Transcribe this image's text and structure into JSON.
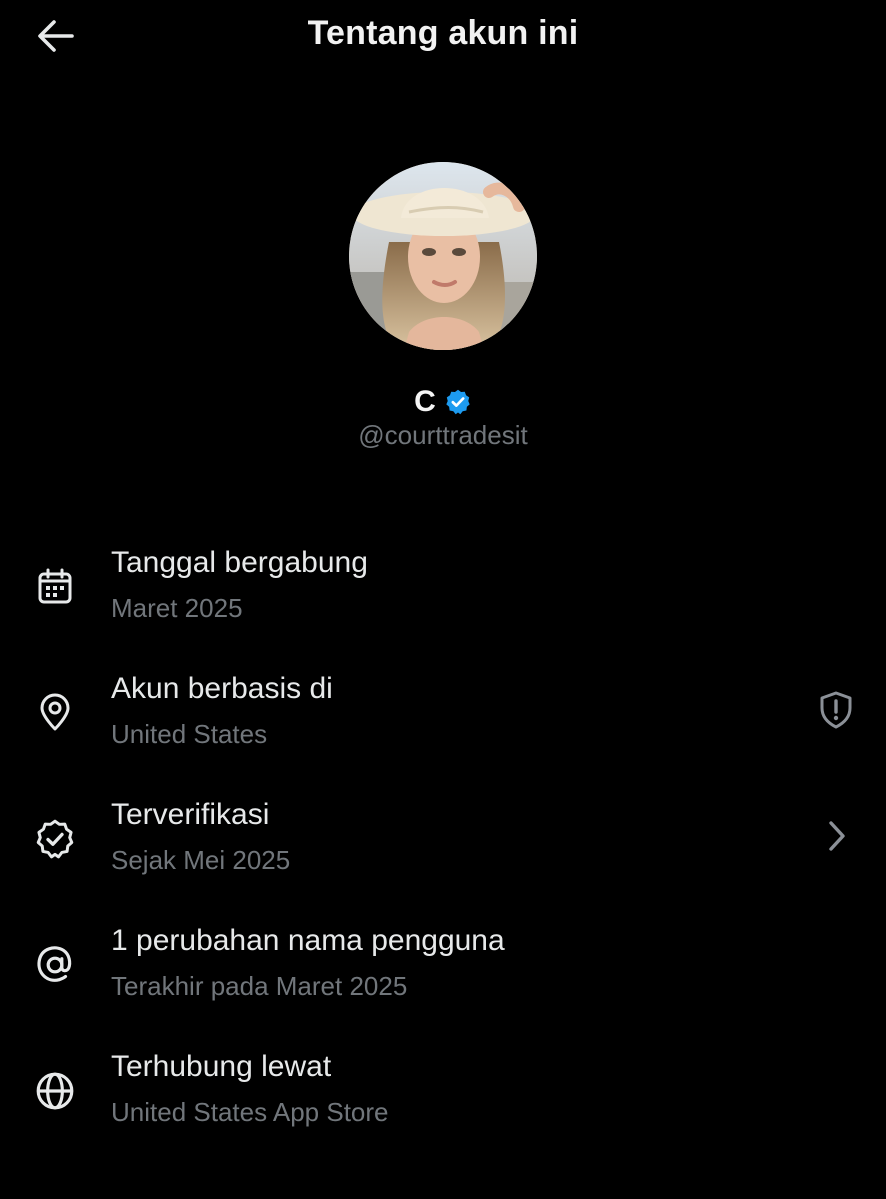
{
  "header": {
    "title": "Tentang akun ini",
    "back_icon": "arrow-left-icon"
  },
  "profile": {
    "display_name": "C",
    "handle": "@courttradesit",
    "verified_badge_color": "#1d9bf0",
    "verified_icon": "verified-badge-icon"
  },
  "colors": {
    "background": "#000000",
    "primary_text": "#e7e9ea",
    "secondary_text": "#71767b",
    "accent": "#1d9bf0"
  },
  "info_rows": [
    {
      "icon": "calendar-icon",
      "label": "Tanggal bergabung",
      "value": "Maret 2025"
    },
    {
      "icon": "location-pin-icon",
      "label": "Akun berbasis di",
      "value": "United States",
      "trailing_icon": "shield-alert-icon"
    },
    {
      "icon": "verified-check-icon",
      "label": "Terverifikasi",
      "value": "Sejak Mei 2025",
      "trailing_icon": "chevron-right-icon"
    },
    {
      "icon": "at-sign-icon",
      "label": "1 perubahan nama pengguna",
      "value": "Terakhir pada Maret 2025"
    },
    {
      "icon": "globe-icon",
      "label": "Terhubung lewat",
      "value": "United States App Store"
    }
  ]
}
